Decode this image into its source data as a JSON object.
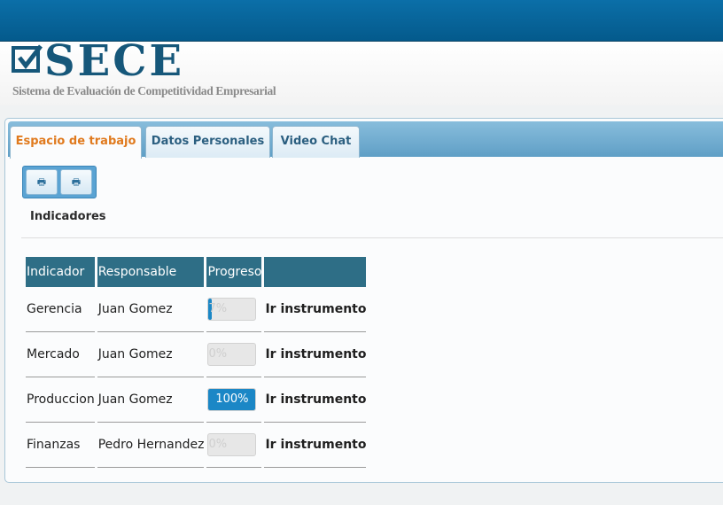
{
  "header": {
    "logo_text": "SECE",
    "logo_subtitle": "Sistema de Evaluación de Competitividad Empresarial"
  },
  "tabs": [
    {
      "label": "Espacio de trabajo",
      "active": true
    },
    {
      "label": "Datos Personales",
      "active": false
    },
    {
      "label": "Video Chat",
      "active": false
    }
  ],
  "toolbar": {
    "buttons": [
      "print-icon",
      "print-icon"
    ]
  },
  "section": {
    "title": "Indicadores"
  },
  "table": {
    "headers": [
      "Indicador",
      "Responsable",
      "Progreso",
      ""
    ],
    "rows": [
      {
        "indicador": "Gerencia",
        "responsable": "Juan Gomez",
        "progress": 7,
        "progress_label": "7%",
        "action": "Ir instrumento"
      },
      {
        "indicador": "Mercado",
        "responsable": "Juan Gomez",
        "progress": 0,
        "progress_label": "0%",
        "action": "Ir instrumento"
      },
      {
        "indicador": "Produccion",
        "responsable": "Juan Gomez",
        "progress": 100,
        "progress_label": "100%",
        "action": "Ir instrumento"
      },
      {
        "indicador": "Finanzas",
        "responsable": "Pedro Hernandez",
        "progress": 0,
        "progress_label": "0%",
        "action": "Ir instrumento"
      }
    ]
  },
  "colors": {
    "accent": "#1b87c6",
    "header_bar": "#045a8c",
    "table_header": "#2e6e86",
    "active_tab_text": "#e07a1e"
  }
}
